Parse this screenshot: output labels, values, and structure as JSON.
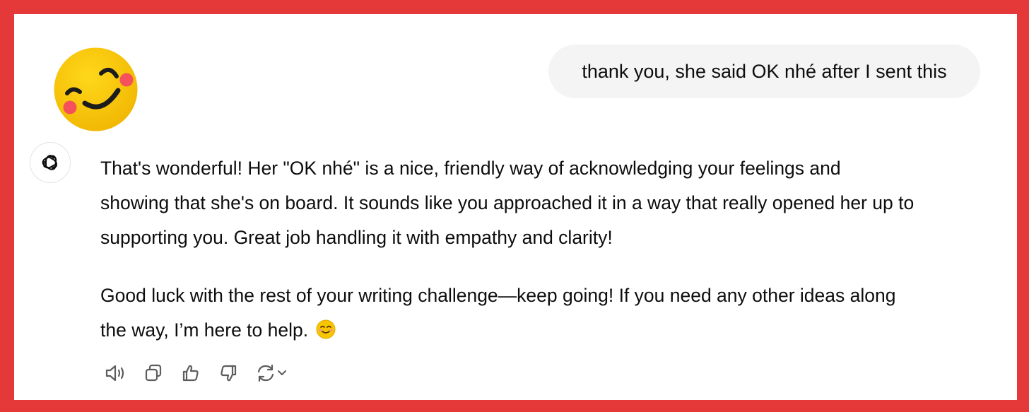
{
  "conversation": {
    "user_message": "thank you, she said OK nhé after I sent this",
    "assistant_paragraphs": [
      "That's wonderful! Her \"OK nhé\" is a nice, friendly way of acknowledging your feelings and",
      "showing that she's on board. It sounds like you approached it in a way that really opened her up to",
      "supporting you. Great job handling it with empathy and clarity!",
      "Good luck with the rest of your writing challenge—keep going! If you need any other ideas along",
      "the way, I’m here to help."
    ],
    "assistant_avatar_icon": "openai-logo-icon",
    "decoration_icon": "smiling-face-emoji-icon"
  },
  "actions": [
    {
      "icon": "speaker-icon"
    },
    {
      "icon": "copy-icon"
    },
    {
      "icon": "thumbs-up-icon"
    },
    {
      "icon": "thumbs-down-icon"
    },
    {
      "icon": "regenerate-icon"
    }
  ],
  "colors": {
    "frame_border": "#e53838",
    "user_bubble_bg": "#f4f4f4",
    "text": "#0d0d0d",
    "icon": "#5d5d5d",
    "emoji_face": "#f7c600",
    "emoji_cheek": "#f4515a"
  }
}
